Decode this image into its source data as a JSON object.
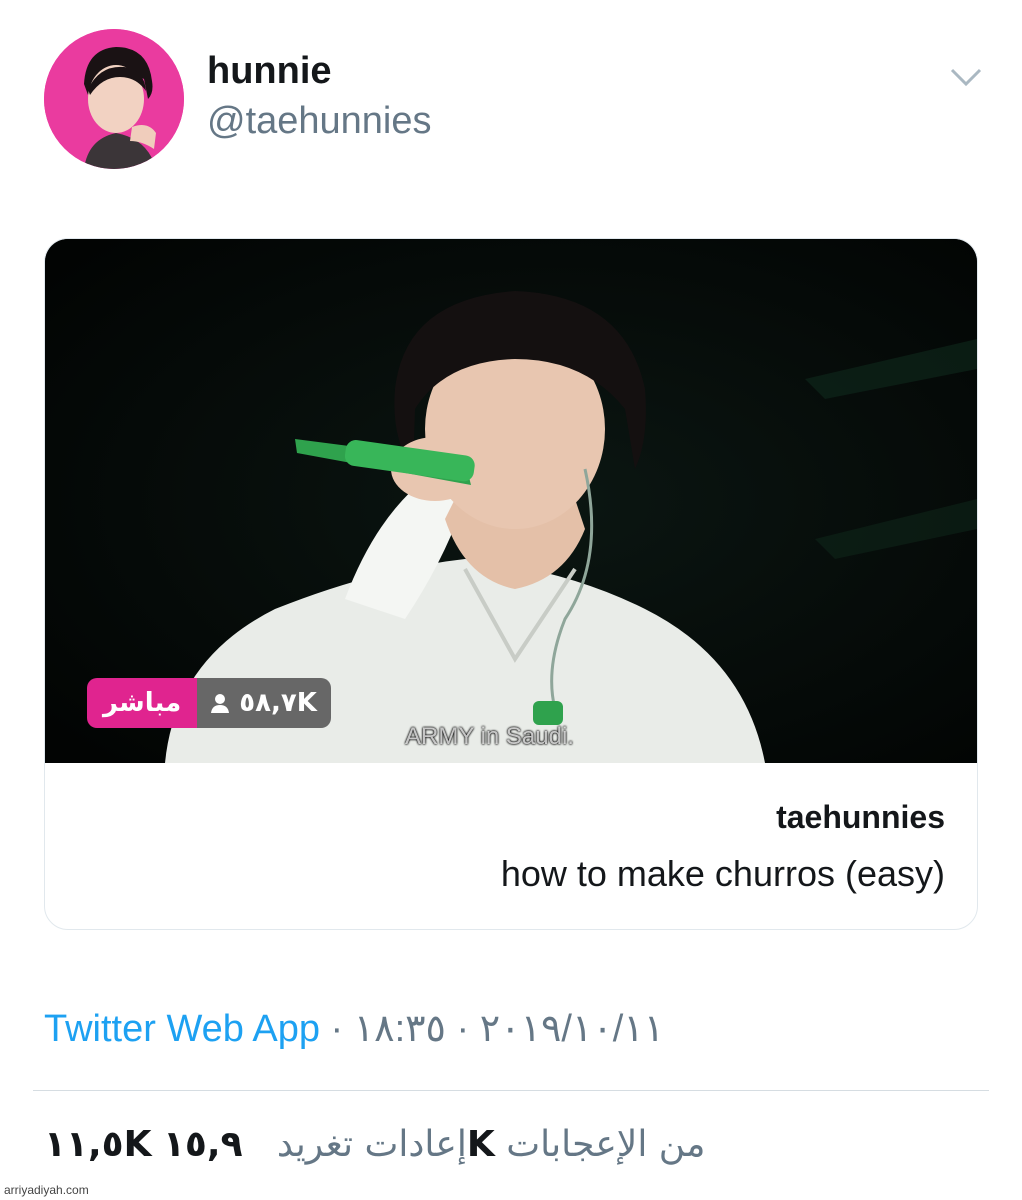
{
  "header": {
    "display_name": "hunnie",
    "handle": "@taehunnies",
    "avatar_icon": "profile-avatar",
    "menu_icon": "chevron-down-icon"
  },
  "card": {
    "media": {
      "live_label": "مباشر",
      "viewer_count": "٥٨,٧K",
      "viewer_icon": "person-icon",
      "caption": "ARMY in Saudi."
    },
    "author": "taehunnies",
    "title": "how to make churros (easy)"
  },
  "meta": {
    "source": "Twitter Web App",
    "date": "٢٠١٩/١٠/١١",
    "time": "١٨:٣٥",
    "separator": "·"
  },
  "stats": {
    "retweets_count": "١١,٥K",
    "retweets_label": "إعادات تغريد",
    "likes_count": "١٥,٩K",
    "likes_label": "من الإعجابات"
  },
  "footer": {
    "site": "arriyadiyah.com"
  },
  "colors": {
    "accent": "#1da1f2",
    "live": "#e0248f",
    "muted": "#657786"
  }
}
